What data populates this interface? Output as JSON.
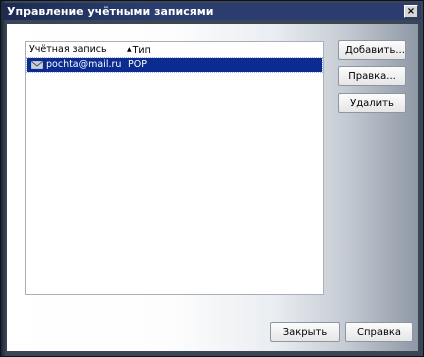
{
  "window": {
    "title": "Управление учётными записями",
    "close_glyph": "×"
  },
  "list": {
    "columns": [
      {
        "label": "Учётная запись"
      },
      {
        "label": "Тип",
        "sort_arrow": "▲"
      }
    ],
    "rows": [
      {
        "icon": "envelope-icon",
        "email": "pochta@mail.ru",
        "type": "POP",
        "selected": true
      }
    ]
  },
  "buttons": {
    "add": "Добавить...",
    "edit": "Правка...",
    "delete": "Удалить",
    "close": "Закрыть",
    "help": "Справка"
  },
  "colors": {
    "selection": "#0b2b8e",
    "titlebar": "#2a3d6e",
    "frame": "#3a4656"
  }
}
